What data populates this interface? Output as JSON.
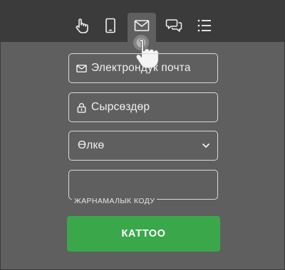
{
  "tabs": [
    {
      "icon": "tap-hand-icon"
    },
    {
      "icon": "phone-icon"
    },
    {
      "icon": "envelope-icon",
      "active": true
    },
    {
      "icon": "chat-bubbles-icon"
    },
    {
      "icon": "list-icon"
    }
  ],
  "form": {
    "email_placeholder": "Электрондук почта",
    "password_placeholder": "Сырсөздөр",
    "country_value": "Өлкө",
    "promo_label": "ЖАРНАМАЛЫК КОДУ",
    "promo_value": "",
    "register_label": "КАТТОО"
  },
  "colors": {
    "background": "#5f5f5f",
    "topbar": "#3b3b3b",
    "register_button": "#3aa84a",
    "field_border": "#d9d9d9"
  }
}
